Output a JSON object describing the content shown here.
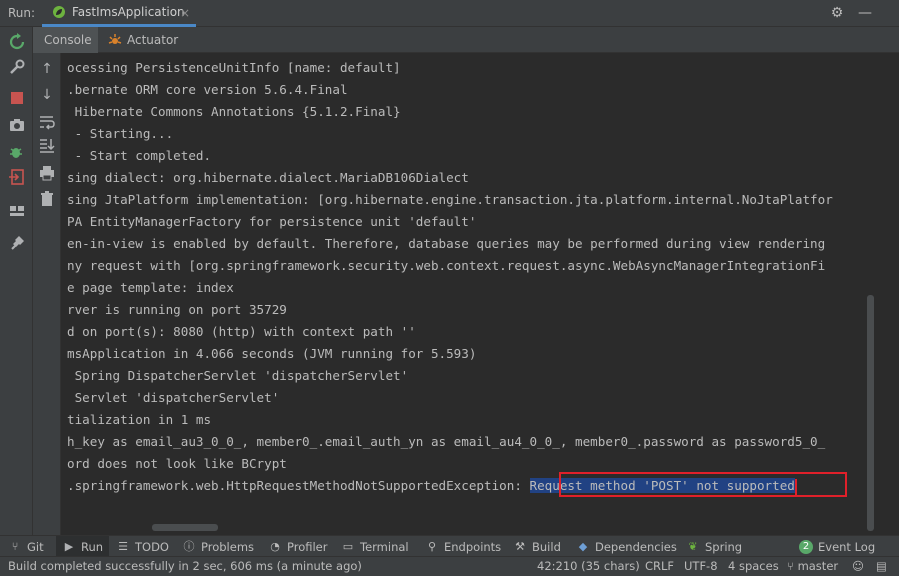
{
  "run_panel": {
    "label": "Run:",
    "tab_title": "FastImsApplication",
    "tab_close": "×"
  },
  "sub_tabs": {
    "console": "Console",
    "actuator": "Actuator"
  },
  "console": {
    "lines": [
      "ocessing PersistenceUnitInfo [name: default]",
      ".bernate ORM core version 5.6.4.Final",
      " Hibernate Commons Annotations {5.1.2.Final}",
      " - Starting...",
      " - Start completed.",
      "sing dialect: org.hibernate.dialect.MariaDB106Dialect",
      "sing JtaPlatform implementation: [org.hibernate.engine.transaction.jta.platform.internal.NoJtaPlatfor",
      "PA EntityManagerFactory for persistence unit 'default'",
      "en-in-view is enabled by default. Therefore, database queries may be performed during view rendering",
      "ny request with [org.springframework.security.web.context.request.async.WebAsyncManagerIntegrationFi",
      "e page template: index",
      "rver is running on port 35729",
      "d on port(s): 8080 (http) with context path ''",
      "msApplication in 4.066 seconds (JVM running for 5.593)",
      " Spring DispatcherServlet 'dispatcherServlet'",
      " Servlet 'dispatcherServlet'",
      "tialization in 1 ms",
      "h_key as email_au3_0_0_, member0_.email_auth_yn as email_au4_0_0_, member0_.password as password5_0_",
      "ord does not look like BCrypt"
    ],
    "last_line_prefix": ".springframework.web.HttpRequestMethodNotSupportedException: ",
    "last_line_selected": "Request method 'POST' not supported"
  },
  "bottom_tools": {
    "git": "Git",
    "run": "Run",
    "todo": "TODO",
    "problems": "Problems",
    "profiler": "Profiler",
    "terminal": "Terminal",
    "endpoints": "Endpoints",
    "build": "Build",
    "dependencies": "Dependencies",
    "spring": "Spring",
    "event_log_count": "2",
    "event_log": "Event Log"
  },
  "status_bar": {
    "message": "Build completed successfully in 2 sec, 606 ms (a minute ago)",
    "position": "42:210 (35 chars)",
    "line_separator": "CRLF",
    "encoding": "UTF-8",
    "indent": "4 spaces",
    "branch": "master"
  },
  "colors": {
    "background": "#2b2b2b",
    "panel": "#3c3f41",
    "accent": "#4a88c7",
    "selection": "#214283",
    "highlight_box": "#e0202a",
    "rerun_green": "#59a869",
    "stop_red": "#c75450"
  },
  "icons": [
    "rerun-icon",
    "wrench-icon",
    "stop-icon",
    "camera-icon",
    "debug-icon",
    "exit-icon",
    "layout-icon",
    "pin-icon",
    "arrow-up-icon",
    "arrow-down-icon",
    "soft-wrap-icon",
    "scroll-end-icon",
    "print-icon",
    "trash-icon",
    "gear-icon",
    "minimize-icon",
    "spring-leaf-icon"
  ]
}
